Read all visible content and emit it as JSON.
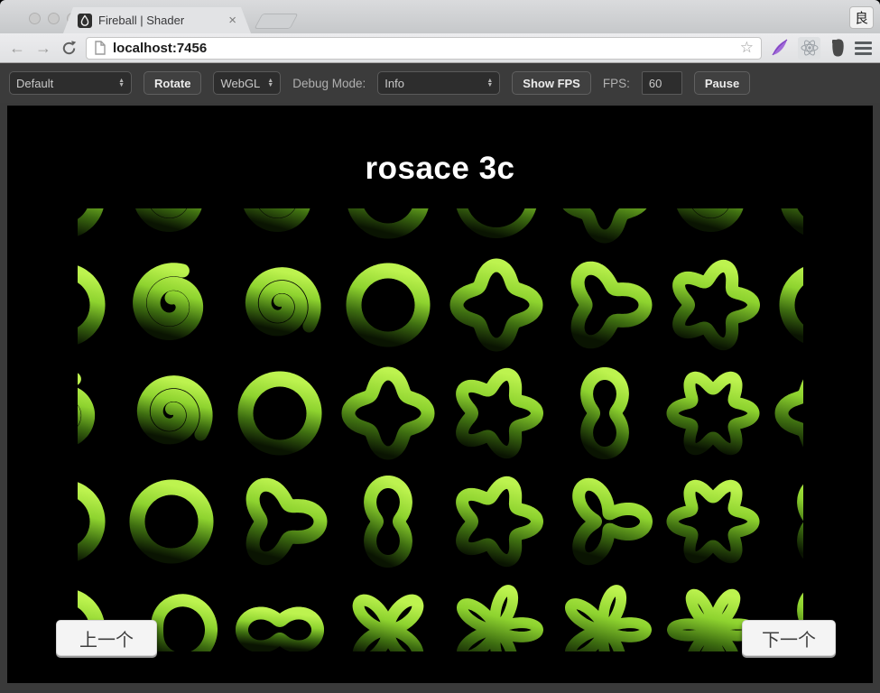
{
  "browser": {
    "tab_title": "Fireball | Shader",
    "url": "localhost:7456",
    "profile_badge": "良"
  },
  "ui": {
    "close_tab": "×",
    "back": "←",
    "forward": "→",
    "star": "☆",
    "select_up": "▲",
    "select_down": "▼"
  },
  "toolbar": {
    "preset_select_value": "Default",
    "rotate_button": "Rotate",
    "renderer_select_value": "WebGL",
    "debug_mode_label": "Debug Mode:",
    "debug_select_value": "Info",
    "show_fps_button": "Show FPS",
    "fps_label": "FPS:",
    "fps_value": "60",
    "pause_button": "Pause"
  },
  "canvas": {
    "title": "rosace 3c",
    "prev_label": "上一个",
    "next_label": "下一个",
    "colors": {
      "bright_green": "#b9f04b",
      "mid_green": "#8ed32f",
      "dark_green": "#3c6b10",
      "shadow_green": "#0a1402",
      "background": "#000000"
    },
    "gradient_stops": [
      [
        "0%",
        "#bdf34f"
      ],
      [
        "35%",
        "#8ed32f"
      ],
      [
        "68%",
        "#3e6e11"
      ],
      [
        "100%",
        "#0a1402"
      ]
    ],
    "grid": {
      "col_centers": [
        -16,
        104,
        224,
        344,
        464,
        584,
        704,
        824
      ],
      "row_centers": [
        -13,
        107,
        227,
        347,
        467
      ],
      "shapes": {
        "ring": {
          "t": "rose",
          "k": 0,
          "b": 38,
          "a": 0,
          "w": 17
        },
        "thinring": {
          "t": "rose",
          "k": 0,
          "b": 40,
          "a": 0,
          "w": 12
        },
        "swirl": {
          "t": "spiral",
          "turns": 2.05,
          "r0": 8,
          "r1": 40,
          "w": 15
        },
        "swirl2": {
          "t": "spiral",
          "turns": 2.35,
          "r0": 5,
          "r1": 40,
          "w": 14
        },
        "knot4": {
          "t": "rose",
          "k": 4,
          "b": 36,
          "a": 8,
          "w": 15
        },
        "knot5": {
          "t": "rose",
          "k": 5,
          "b": 36,
          "a": 9,
          "w": 14
        },
        "knot6": {
          "t": "rose",
          "k": 6,
          "b": 36,
          "a": 9,
          "w": 13
        },
        "trefoil": {
          "t": "rose",
          "k": 3,
          "b": 33,
          "a": 12,
          "w": 15
        },
        "peanut": {
          "t": "rose",
          "k": 2,
          "b": 28,
          "a": 16,
          "w": 14,
          "p": 180
        },
        "clover3": {
          "t": "rose",
          "k": 3,
          "b": 28,
          "a": 18,
          "w": 14
        },
        "cross4": {
          "t": "rose",
          "k": 4,
          "b": 24,
          "a": 20,
          "w": 13,
          "p": 180
        },
        "flower5": {
          "t": "rose",
          "k": 5,
          "b": 25,
          "a": 21,
          "w": 12
        },
        "flower6": {
          "t": "rose",
          "k": 6,
          "b": 25,
          "a": 20,
          "w": 12
        },
        "heart2": {
          "t": "rose",
          "k": 2,
          "b": 26,
          "a": 16,
          "w": 14
        },
        "loop": {
          "t": "rose",
          "k": 1,
          "b": 30,
          "a": 14,
          "w": 14
        }
      },
      "cells": [
        [
          "ring",
          "swirl",
          "swirl",
          "ring",
          "thinring",
          "knot4",
          "swirl",
          "ring"
        ],
        [
          "ring",
          "swirl",
          "swirl2",
          "ring",
          "knot4",
          "trefoil",
          "knot5",
          "ring"
        ],
        [
          "swirl",
          "swirl2",
          "ring",
          "knot4",
          "knot5",
          "peanut",
          "knot6",
          "knot4"
        ],
        [
          "ring",
          "ring",
          "trefoil",
          "peanut",
          "knot5",
          "clover3",
          "knot6",
          "peanut"
        ],
        [
          "ring",
          "loop",
          "heart2",
          "cross4",
          "flower5",
          "flower5",
          "flower6",
          "peanut"
        ]
      ]
    }
  }
}
